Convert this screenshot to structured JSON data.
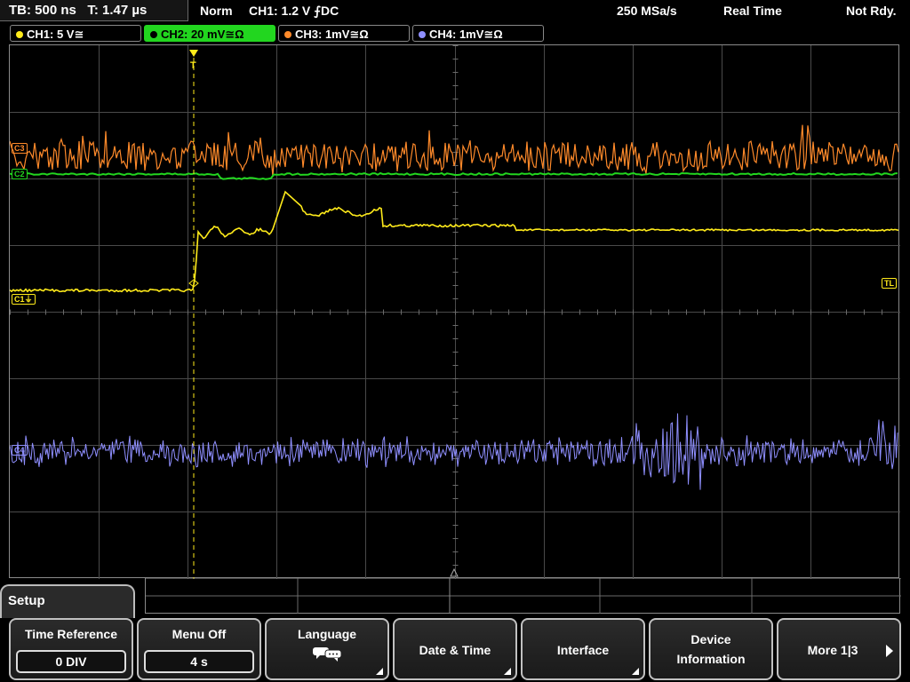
{
  "status": {
    "timebase": "TB: 500 ns",
    "time": "T: 1.47 µs",
    "mode": "Norm",
    "trigger": "CH1: 1.2 V ⨍DC",
    "sample_rate": "250 MSa/s",
    "acq_mode": "Real Time",
    "state": "Not Rdy."
  },
  "channels": [
    {
      "label": "CH1: 5 V≅",
      "color": "#ffeb1a",
      "active": false
    },
    {
      "label": "CH2: 20 mV≅Ω",
      "color": "#22d61f",
      "active": true
    },
    {
      "label": "CH3: 1mV≅Ω",
      "color": "#ff8a2a",
      "active": false
    },
    {
      "label": "CH4: 1mV≅Ω",
      "color": "#8f8fff",
      "active": false
    }
  ],
  "markers": {
    "ch1": "C1",
    "trigger_level": "TL",
    "trigger_position": "T"
  },
  "menu": {
    "title": "Setup",
    "softkeys": [
      {
        "label": "Time Reference",
        "value": "0 DIV"
      },
      {
        "label": "Menu Off",
        "value": "4 s"
      },
      {
        "label": "Language",
        "icon": "speech-bubble-icon"
      },
      {
        "label": "Date & Time"
      },
      {
        "label": "Interface"
      },
      {
        "label1": "Device",
        "label2": "Information"
      },
      {
        "label": "More 1|3"
      }
    ]
  },
  "colors": {
    "ch1": "#ffeb1a",
    "ch2": "#22d61f",
    "ch3": "#ff8a2a",
    "ch4": "#8f8fff",
    "grid": "#4a4a4a"
  }
}
